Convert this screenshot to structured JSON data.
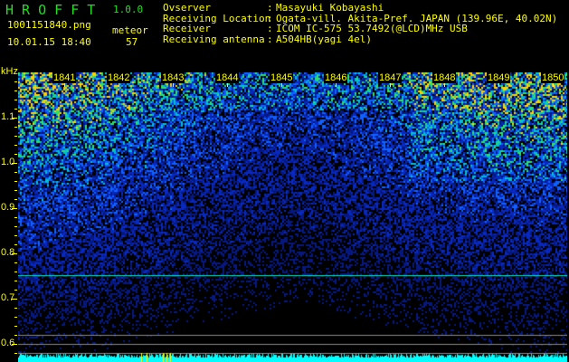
{
  "header": {
    "app_name": "H R O F F T",
    "version": "1.0.0",
    "filename": "1001151840.png",
    "datetime": "10.01.15 18:40",
    "mode_label": "meteor",
    "count": "57",
    "info": [
      {
        "label": "Ovserver",
        "value": "Masayuki Kobayashi"
      },
      {
        "label": "Receiving Location",
        "value": "Ogata-vill. Akita-Pref. JAPAN (139.96E, 40.02N)"
      },
      {
        "label": "Receiver",
        "value": "ICOM IC-575 53.7492(@LCD)MHz USB"
      },
      {
        "label": "Receiving antenna",
        "value": "A504HB(yagi 4el)"
      }
    ]
  },
  "spectrogram": {
    "y_unit": "kHz",
    "y_ticks": [
      "1.1",
      "1.0",
      "0.9",
      "0.8",
      "0.7",
      "0.6"
    ],
    "time_labels": [
      "1841",
      "1842",
      "1843",
      "1844",
      "1845",
      "1846",
      "1847",
      "1848",
      "1849",
      "1850"
    ],
    "colors": {
      "text": "#ffff00",
      "title": "#22dd22",
      "marker_line": "#00e0c0",
      "baseline": "#00ffff"
    }
  }
}
